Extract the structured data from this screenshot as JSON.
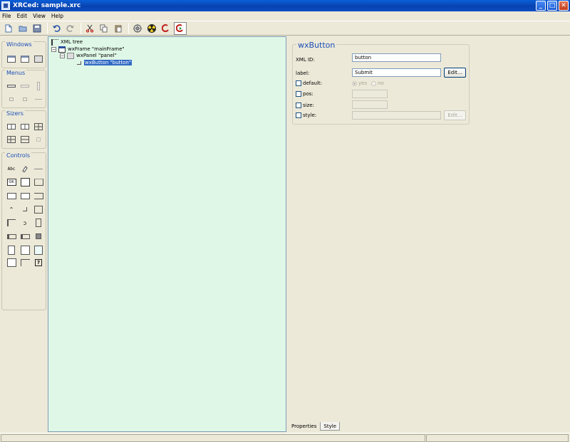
{
  "window": {
    "title": "XRCed: sample.xrc"
  },
  "menu": [
    "File",
    "Edit",
    "View",
    "Help"
  ],
  "palette": {
    "windows": "Windows",
    "menus": "Menus",
    "sizers": "Sizers",
    "controls": "Controls",
    "text_glyph": "Abc",
    "ok_glyph": "OK",
    "help_glyph": "?"
  },
  "tree": {
    "root": "XML tree",
    "frame": "wxFrame \"mainFrame\"",
    "panel": "wxPanel \"panel\"",
    "button": "wxButton \"button\""
  },
  "props": {
    "heading": "wxButton",
    "xml_id_label": "XML ID:",
    "xml_id_value": "button",
    "label_label": "label:",
    "label_value": "Submit",
    "edit_label": "Edit...",
    "default_label": "default:",
    "yes": "yes",
    "no": "no",
    "pos_label": "pos:",
    "size_label": "size:",
    "style_label": "style:",
    "edit_disabled_label": "Edit..."
  },
  "tabs": [
    "Properties",
    "Style"
  ],
  "colors": {
    "tree_bg": "#dff7e6",
    "selection": "#316ac5",
    "accent": "#1c4fb8"
  }
}
